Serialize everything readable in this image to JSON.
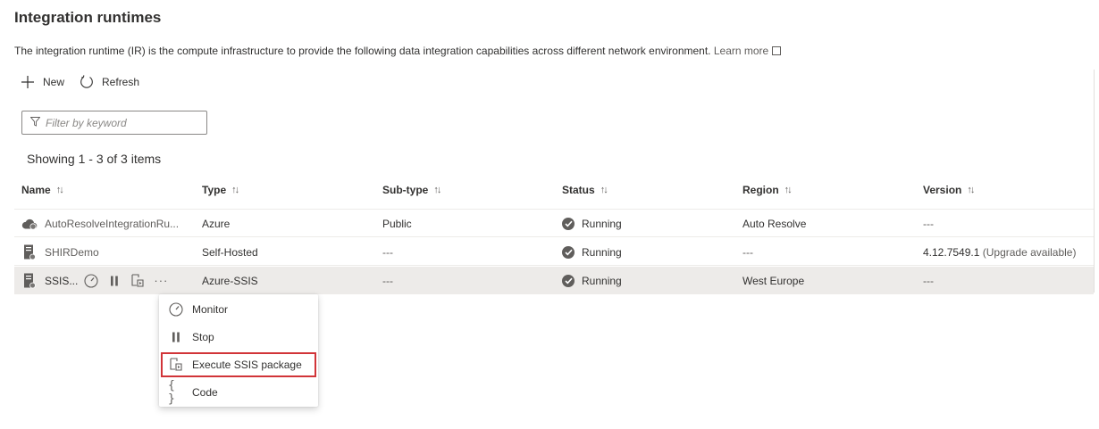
{
  "page": {
    "title": "Integration runtimes",
    "description": "The integration runtime (IR) is the compute infrastructure to provide the following data integration capabilities across different network environment.",
    "learn_more": "Learn more"
  },
  "toolbar": {
    "new_label": "New",
    "refresh_label": "Refresh"
  },
  "filter": {
    "placeholder": "Filter by keyword",
    "value": ""
  },
  "showing_text": "Showing 1 - 3 of 3 items",
  "table": {
    "columns": [
      "Name",
      "Type",
      "Sub-type",
      "Status",
      "Region",
      "Version"
    ],
    "rows": [
      {
        "name": "AutoResolveIntegrationRu...",
        "icon": "cloud-icon",
        "type": "Azure",
        "subtype": "Public",
        "status": "Running",
        "region": "Auto Resolve",
        "version": "---",
        "version_note": ""
      },
      {
        "name": "SHIRDemo",
        "icon": "server-icon",
        "type": "Self-Hosted",
        "subtype": "---",
        "status": "Running",
        "region": "---",
        "version": "4.12.7549.1",
        "version_note": "(Upgrade available)"
      },
      {
        "name": "SSIS...",
        "icon": "ssis-server-icon",
        "type": "Azure-SSIS",
        "subtype": "---",
        "status": "Running",
        "region": "West Europe",
        "version": "---",
        "version_note": "",
        "selected": true
      }
    ]
  },
  "context_menu": {
    "items": [
      {
        "label": "Monitor",
        "icon": "gauge-icon"
      },
      {
        "label": "Stop",
        "icon": "pause-icon"
      },
      {
        "label": "Execute SSIS package",
        "icon": "execute-package-icon",
        "highlighted": true
      },
      {
        "label": "Code",
        "icon": "braces-icon"
      }
    ]
  },
  "colors": {
    "text": "#323130",
    "muted": "#605e5c",
    "selected_row": "#edebe9",
    "highlight_border": "#d13438"
  }
}
